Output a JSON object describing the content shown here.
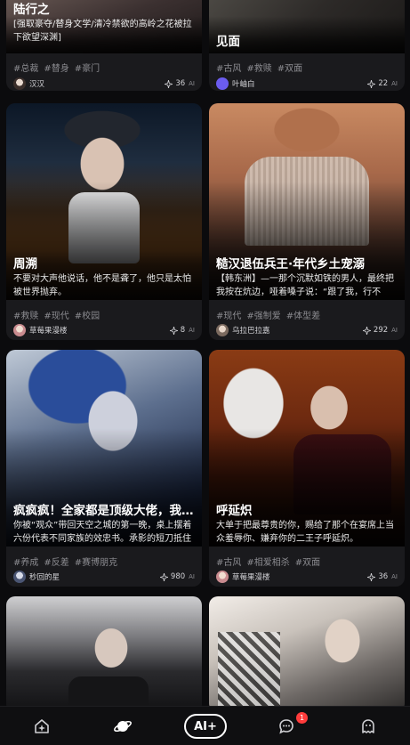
{
  "feed": {
    "cards": [
      {
        "title": "陆行之",
        "desc": "[强取豪夺/替身文学/清冷禁欲的高岭之花被拉下欲望深渊]",
        "tags": [
          "#总裁",
          "#替身",
          "#豪门"
        ],
        "author": "汉汉",
        "count": "36",
        "ai": "AI"
      },
      {
        "title": "见面",
        "desc": "",
        "tags": [
          "#古风",
          "#救赎",
          "#双面"
        ],
        "author": "叶岫白",
        "count": "22",
        "ai": "AI"
      },
      {
        "title": "周溯",
        "desc": "不要对大声他说话，他不是聋了，他只是太怕被世界抛弃。",
        "tags": [
          "#救赎",
          "#现代",
          "#校园"
        ],
        "author": "草莓果漫楼",
        "count": "8",
        "ai": "AI"
      },
      {
        "title": "糙汉退伍兵王·年代乡土宠溺",
        "desc": "【韩东洲】—一那个沉默如铁的男人，最终把我按在炕边，哑着嗓子说：“跟了我，行不行？”",
        "tags": [
          "#现代",
          "#强制爱",
          "#体型差"
        ],
        "author": "乌拉巴拉嘉",
        "count": "292",
        "ai": "AI"
      },
      {
        "title": "疯疯疯！全家都是顶级大佬，我…",
        "desc": "你被“观众”带回天空之城的第一晚，桌上摆着六份代表不同家族的效忠书。承影的短刀抵住你…",
        "tags": [
          "#养成",
          "#反差",
          "#赛博朋克"
        ],
        "author": "秒回的星",
        "count": "980",
        "ai": "AI"
      },
      {
        "title": "呼延炽",
        "desc": "大单于把最尊贵的你，赐给了那个在宴席上当众羞辱你、嫌弃你的二王子呼延炽。",
        "tags": [
          "#古风",
          "#相爱相杀",
          "#双面"
        ],
        "author": "草莓果漫楼",
        "count": "36",
        "ai": "AI"
      },
      {
        "title": "",
        "desc": ""
      },
      {
        "title": "",
        "desc": ""
      }
    ]
  },
  "nav": {
    "items": [
      "home-icon",
      "planet-icon",
      "ai-create",
      "chat-icon",
      "ghost-icon"
    ],
    "ai_label": "AI+",
    "badge": "1"
  },
  "colors": {
    "background": "#0b0b0d",
    "card": "#1a1a1d",
    "tag": "#8b8b90",
    "badge": "#ff3b3b"
  }
}
